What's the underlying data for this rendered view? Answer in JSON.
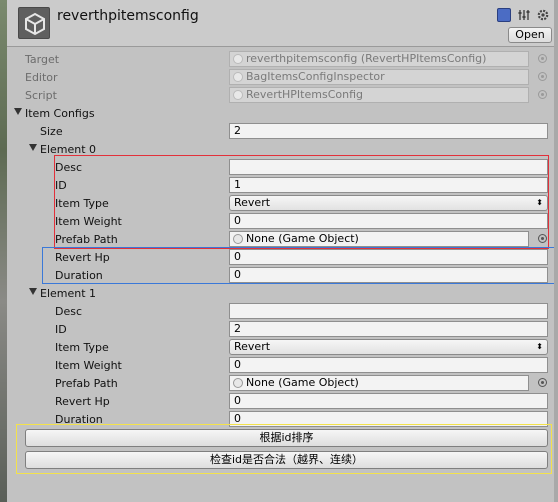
{
  "header": {
    "title": "reverthpitemsconfig",
    "open_label": "Open"
  },
  "script_info": {
    "target_label": "Target",
    "target_value": "reverthpitemsconfig (RevertHPItemsConfig)",
    "editor_label": "Editor",
    "editor_value": "BagItemsConfigInspector",
    "script_label": "Script",
    "script_value": "RevertHPItemsConfig"
  },
  "item_configs": {
    "label": "Item Configs",
    "size_label": "Size",
    "size_value": "2"
  },
  "elements": [
    {
      "label": "Element 0",
      "desc_label": "Desc",
      "desc_value": "",
      "id_label": "ID",
      "id_value": "1",
      "type_label": "Item Type",
      "type_value": "Revert",
      "weight_label": "Item Weight",
      "weight_value": "0",
      "prefab_label": "Prefab Path",
      "prefab_value": "None (Game Object)",
      "hp_label": "Revert Hp",
      "hp_value": "0",
      "duration_label": "Duration",
      "duration_value": "0"
    },
    {
      "label": "Element 1",
      "desc_label": "Desc",
      "desc_value": "",
      "id_label": "ID",
      "id_value": "2",
      "type_label": "Item Type",
      "type_value": "Revert",
      "weight_label": "Item Weight",
      "weight_value": "0",
      "prefab_label": "Prefab Path",
      "prefab_value": "None (Game Object)",
      "hp_label": "Revert Hp",
      "hp_value": "0",
      "duration_label": "Duration",
      "duration_value": "0"
    }
  ],
  "buttons": {
    "sort_by_id": "根据id排序",
    "validate_id": "检查id是否合法（越界、连续）"
  },
  "colors": {
    "highlight_red": "#e2303a",
    "highlight_blue": "#3a78d8",
    "highlight_yellow": "#f3e24b",
    "panel_bg": "#c2c2c2"
  },
  "icons": [
    "unity-logo-icon",
    "book-icon",
    "sliders-icon",
    "gear-icon",
    "object-picker-icon",
    "dropdown-arrow-icon",
    "foldout-arrow-icon"
  ]
}
